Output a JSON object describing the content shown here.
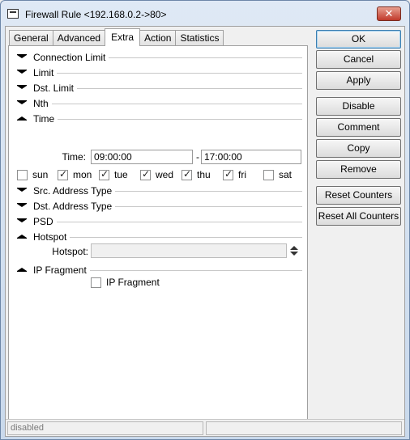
{
  "window": {
    "title": "Firewall Rule <192.168.0.2->80>",
    "close_label": "✕"
  },
  "tabs": [
    "General",
    "Advanced",
    "Extra",
    "Action",
    "Statistics"
  ],
  "sections": {
    "connection_limit": "Connection Limit",
    "limit": "Limit",
    "dst_limit": "Dst. Limit",
    "nth": "Nth",
    "time": "Time",
    "src_address_type": "Src. Address Type",
    "dst_address_type": "Dst. Address Type",
    "psd": "PSD",
    "hotspot": "Hotspot",
    "ip_fragment": "IP Fragment"
  },
  "time": {
    "label": "Time:",
    "from": "09:00:00",
    "separator": "-",
    "to": "17:00:00"
  },
  "days": [
    {
      "label": "sun",
      "checked": false
    },
    {
      "label": "mon",
      "checked": true
    },
    {
      "label": "tue",
      "checked": true
    },
    {
      "label": "wed",
      "checked": true
    },
    {
      "label": "thu",
      "checked": true
    },
    {
      "label": "fri",
      "checked": true
    },
    {
      "label": "sat",
      "checked": false
    }
  ],
  "hotspot": {
    "label": "Hotspot:",
    "value": ""
  },
  "ip_fragment": {
    "checkbox_label": "IP Fragment",
    "checked": false
  },
  "buttons": {
    "ok": "OK",
    "cancel": "Cancel",
    "apply": "Apply",
    "disable": "Disable",
    "comment": "Comment",
    "copy": "Copy",
    "remove": "Remove",
    "reset_counters": "Reset Counters",
    "reset_all_counters": "Reset All Counters"
  },
  "status": {
    "text": "disabled",
    "right": ""
  }
}
